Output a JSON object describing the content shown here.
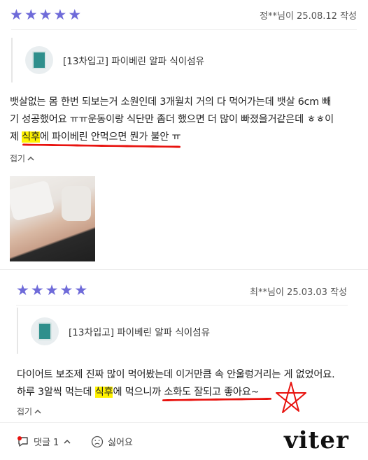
{
  "review1": {
    "rating": 5,
    "author_date": "정**님이 25.08.12 작성",
    "product": "[13차입고] 파이베린 알파 식이섬유",
    "text_parts": [
      "뱃살없는 몸 한번 되보는거 소원인데 3개월치 거의 다 먹어가는데 뱃살 6cm 빼",
      "기 성공했어요 ㅠㅠ운동이랑 식단만 좀더 했으면 더 많이 빠졌을거같은데 ㅎㅎ이",
      "제 ",
      "식후",
      "에 파이베린 안먹으면 뭔가 불안 ㅠ"
    ],
    "fold_label": "접기"
  },
  "review2": {
    "rating": 5,
    "author_date": "최**님이 25.03.03 작성",
    "product": "[13차입고] 파이베린 알파 식이섬유",
    "text_parts": [
      "다이어트 보조제 진짜 많이 먹어봤는데 이거만큼 속 안울렁거리는 게 없었어요.",
      "하루 3알씩 먹는데 ",
      "식후",
      "에 먹으니까 소화도 잘되고 좋아요~"
    ],
    "fold_label": "접기"
  },
  "actions": {
    "comment_label": "댓글 1",
    "dislike_label": "싫어요"
  },
  "colors": {
    "star": "#6f6bd9",
    "highlight": "#fff200",
    "underline": "#e8130f"
  },
  "icons": [
    "star-icon",
    "chevron-up-icon",
    "comment-icon",
    "chevron-down-icon",
    "frown-icon",
    "pentagram-doodle"
  ],
  "logo": "viter"
}
